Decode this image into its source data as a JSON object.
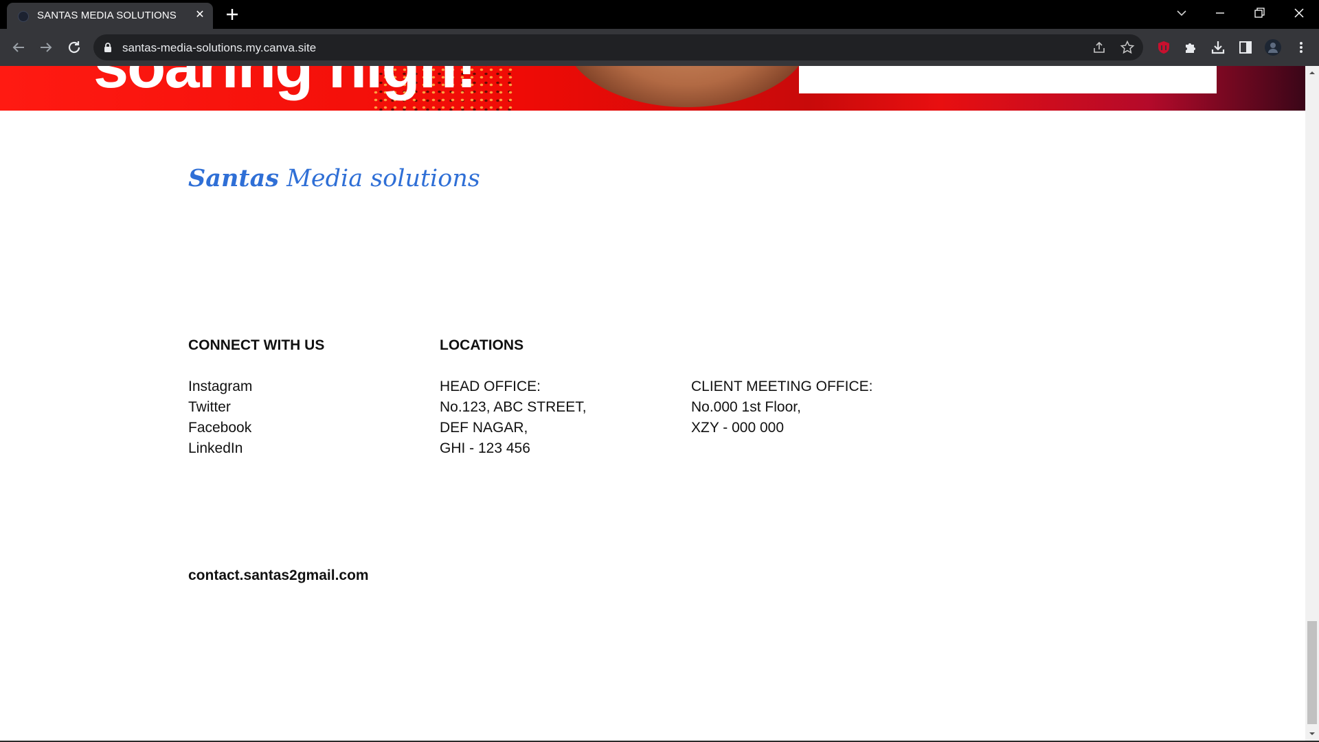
{
  "browser": {
    "tab_title": "SANTAS MEDIA SOLUTIONS",
    "url": "santas-media-solutions.my.canva.site"
  },
  "hero": {
    "heading": "soaring high!"
  },
  "brand": {
    "name_bold": "Santas",
    "name_rest": " Media solutions",
    "color": "#2f6fd6"
  },
  "connect": {
    "heading": "CONNECT WITH US",
    "items": [
      "Instagram",
      "Twitter",
      "Facebook",
      "LinkedIn"
    ]
  },
  "locations": {
    "heading": "LOCATIONS",
    "head_office": [
      "HEAD OFFICE:",
      "No.123, ABC STREET,",
      "DEF NAGAR,",
      "GHI - 123 456"
    ],
    "client_office": [
      "CLIENT MEETING OFFICE:",
      "No.000 1st Floor,",
      "XZY - 000 000"
    ]
  },
  "contact": {
    "email": "contact.santas2gmail.com"
  }
}
